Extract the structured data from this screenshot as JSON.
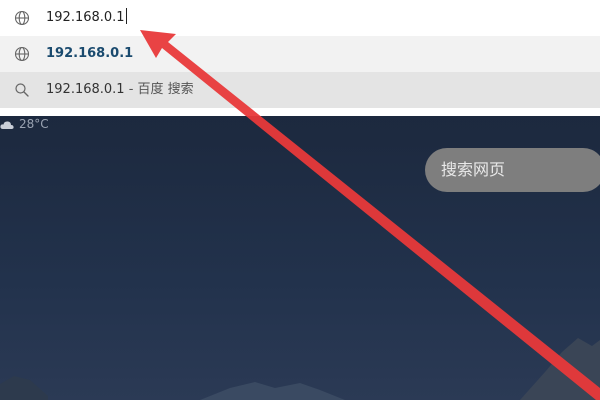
{
  "address_bar": {
    "value": "192.168.0.1",
    "icon": "globe-icon"
  },
  "suggestions": [
    {
      "text": "192.168.0.1",
      "icon": "globe-icon"
    },
    {
      "text": "192.168.0.1",
      "separator": " - ",
      "subtext": "百度 搜索",
      "icon": "search-icon"
    }
  ],
  "weather": {
    "temp": "28°C",
    "icon": "cloud-icon"
  },
  "newtab": {
    "search_placeholder": "搜索网页"
  },
  "colors": {
    "annotation_arrow": "#e8393a"
  }
}
